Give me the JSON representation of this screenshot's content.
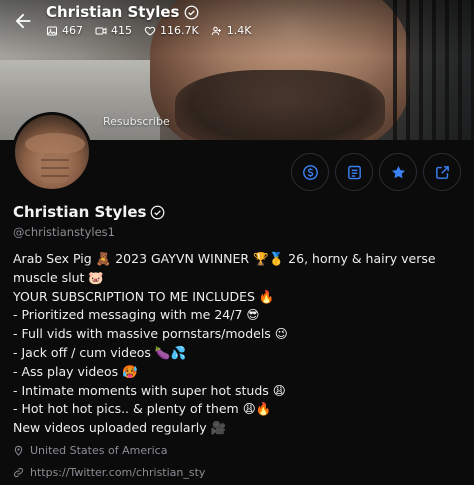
{
  "profile": {
    "name": "Christian Styles",
    "handle": "@christianstyles1",
    "resubscribe_label": "Resubscribe"
  },
  "stats": {
    "photos": "467",
    "videos": "415",
    "likes": "116.7K",
    "fans": "1.4K"
  },
  "bio": [
    "Arab Sex Pig 🧸 2023 GAYVN WINNER 🏆🥇 26, horny & hairy verse muscle slut 🐷",
    "YOUR SUBSCRIPTION TO ME INCLUDES 🔥",
    "- Prioritized messaging with me 24/7 😎",
    "- Full vids with massive pornstars/models 😉",
    "- Jack off / cum videos 🍆💦",
    "- Ass play videos 🥵",
    "- Intimate moments with super hot studs 😩",
    "- Hot hot hot pics.. & plenty of them 😩🔥",
    "New videos uploaded regularly 🎥"
  ],
  "location": "United States of America",
  "link": "https://Twitter.com/christian_sty",
  "colors": {
    "accent": "#3b82f6",
    "background": "#0b0b0c",
    "muted_text": "#8a8d93",
    "button_border": "#2a2d33"
  },
  "icons": {
    "back": "arrow-left",
    "verified": "verified-badge",
    "photos": "image",
    "videos": "video-camera",
    "likes": "heart",
    "fans": "users",
    "tip": "dollar-circle",
    "list": "document-lines",
    "favorite": "star",
    "share": "share-arrow",
    "location": "map-pin",
    "link": "chain-link"
  }
}
